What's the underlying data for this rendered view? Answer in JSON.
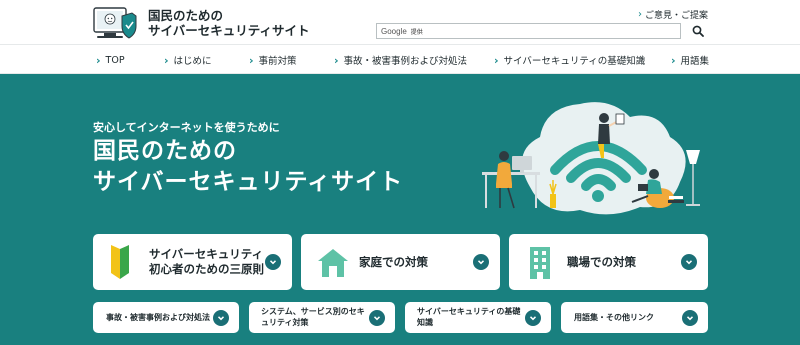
{
  "header": {
    "site_title_line1": "国民のための",
    "site_title_line2": "サイバーセキュリティサイト",
    "feedback_label": "ご意見・ご提案",
    "search": {
      "brand": "Google",
      "placeholder": "提供"
    }
  },
  "nav": {
    "items": [
      {
        "label": "TOP"
      },
      {
        "label": "はじめに"
      },
      {
        "label": "事前対策"
      },
      {
        "label": "事故・被害事例および対処法"
      },
      {
        "label": "サイバーセキュリティの基礎知識"
      },
      {
        "label": "用語集"
      }
    ]
  },
  "hero": {
    "subtitle": "安心してインターネットを使うために",
    "title_line1": "国民のための",
    "title_line2": "サイバーセキュリティサイト"
  },
  "cards": {
    "primary": [
      {
        "label_line1": "サイバーセキュリティ",
        "label_line2": "初心者のための三原則"
      },
      {
        "label_line1": "家庭での対策",
        "label_line2": ""
      },
      {
        "label_line1": "職場での対策",
        "label_line2": ""
      }
    ],
    "secondary": [
      {
        "label_line1": "事故・被害事例および対処法",
        "label_line2": ""
      },
      {
        "label_line1": "システム、サービス別のセキ",
        "label_line2": "ュリティ対策"
      },
      {
        "label_line1": "サイバーセキュリティの基礎",
        "label_line2": "知識"
      },
      {
        "label_line1": "用語集・その他リンク",
        "label_line2": ""
      }
    ]
  },
  "colors": {
    "teal": "#19807f",
    "accent": "#1a8a8c",
    "chevron_bg": "#1a6f76",
    "beginner_green": "#3aa64a",
    "beginner_yellow": "#f2c318",
    "house": "#5ec2a6"
  }
}
